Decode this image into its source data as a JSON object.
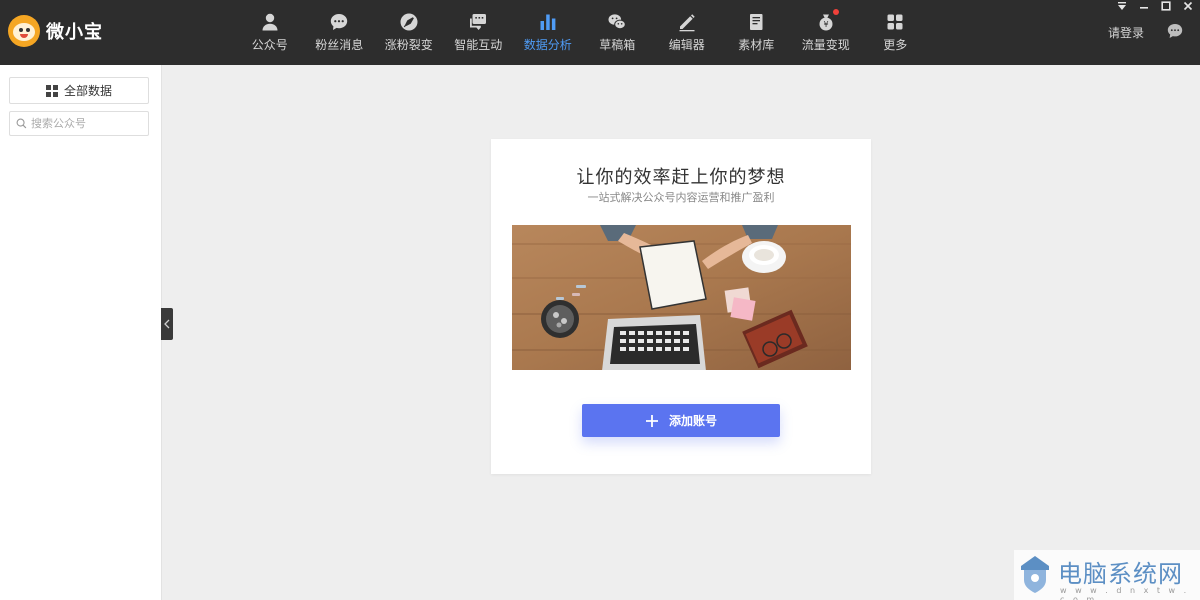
{
  "app": {
    "name": "微小宝"
  },
  "window_controls": {
    "icons": [
      "menu-dropdown-icon",
      "minimize-icon",
      "maximize-icon",
      "close-icon"
    ]
  },
  "nav": {
    "items": [
      {
        "label": "公众号",
        "icon": "user-icon"
      },
      {
        "label": "粉丝消息",
        "icon": "message-icon"
      },
      {
        "label": "涨粉裂变",
        "icon": "rocket-icon"
      },
      {
        "label": "智能互动",
        "icon": "chat-bubbles-icon"
      },
      {
        "label": "数据分析",
        "icon": "bar-chart-icon",
        "active": true
      },
      {
        "label": "草稿箱",
        "icon": "wechat-icon"
      },
      {
        "label": "编辑器",
        "icon": "pencil-icon"
      },
      {
        "label": "素材库",
        "icon": "book-icon"
      },
      {
        "label": "流量变现",
        "icon": "money-bag-icon",
        "badge": true
      },
      {
        "label": "更多",
        "icon": "grid-icon"
      }
    ]
  },
  "header": {
    "login_label": "请登录",
    "chat_icon": "chat-icon"
  },
  "sidebar": {
    "all_data_label": "全部数据",
    "search": {
      "placeholder": "搜索公众号",
      "value": ""
    }
  },
  "card": {
    "title": "让你的效率赶上你的梦想",
    "subtitle": "一站式解决公众号内容运营和推广盈利",
    "add_button_label": "添加账号"
  },
  "watermark": {
    "text": "电脑系统网",
    "url": "w w w . d n x t w . c o m"
  },
  "colors": {
    "topbar": "#2d2d2d",
    "nav_active": "#4f9cf6",
    "primary_button": "#5b74f0",
    "background": "#eeeeee",
    "badge": "#f0413a"
  }
}
